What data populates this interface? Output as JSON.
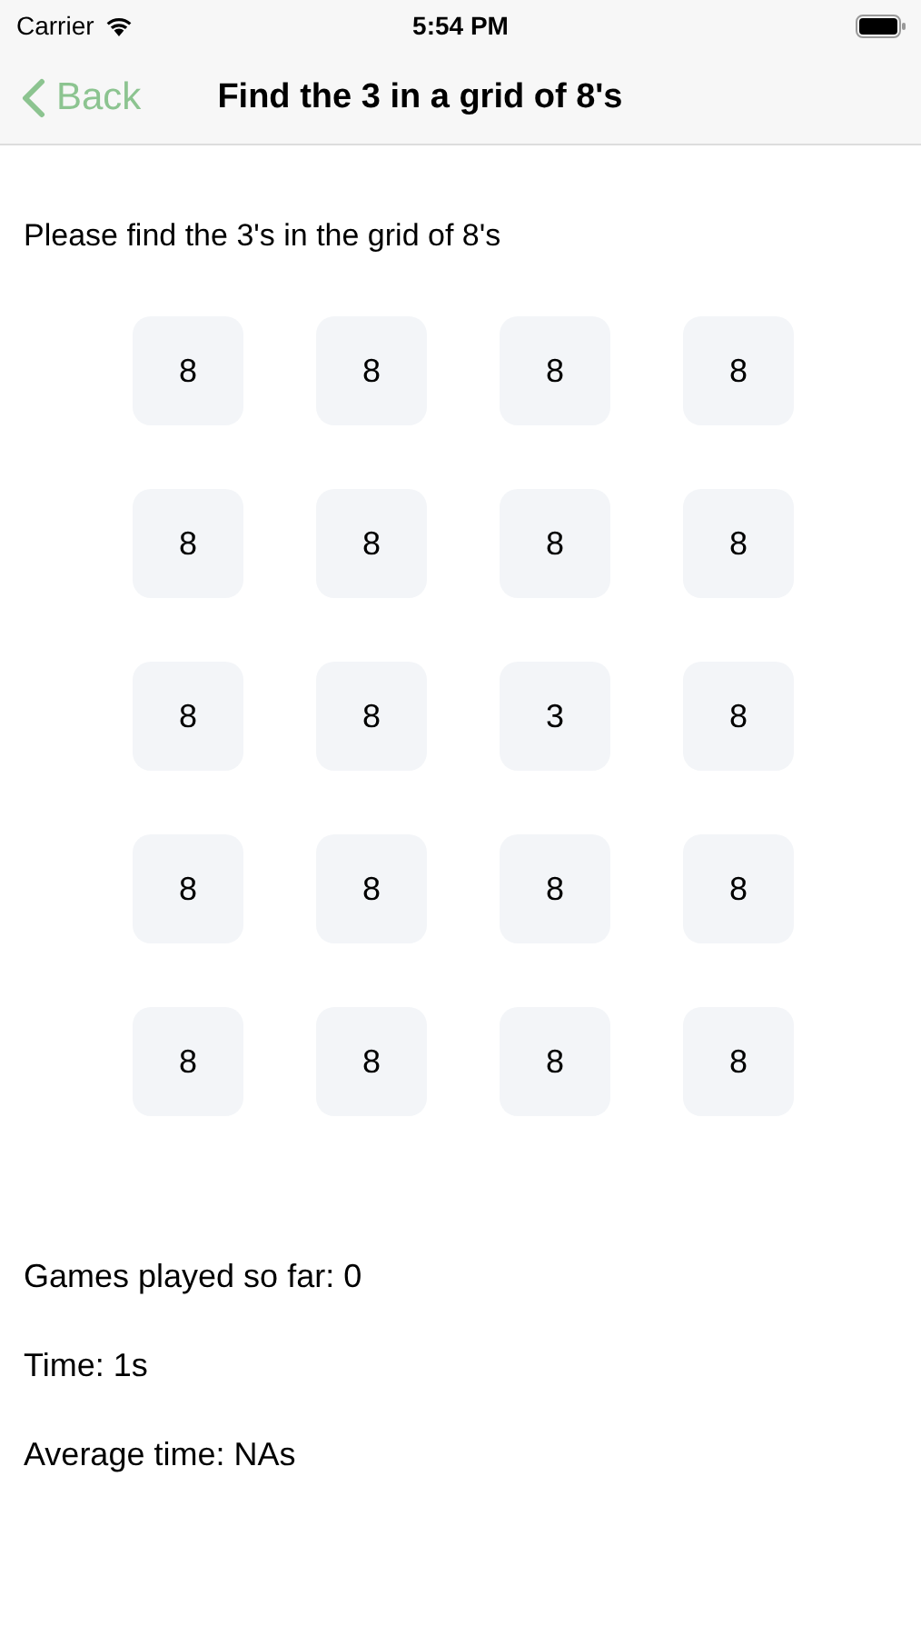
{
  "status_bar": {
    "carrier": "Carrier",
    "time": "5:54 PM"
  },
  "nav": {
    "back": "Back",
    "title": "Find the 3 in a grid of 8's"
  },
  "instruction": "Please find the 3's in the grid of 8's",
  "grid": [
    [
      "8",
      "8",
      "8",
      "8"
    ],
    [
      "8",
      "8",
      "8",
      "8"
    ],
    [
      "8",
      "8",
      "3",
      "8"
    ],
    [
      "8",
      "8",
      "8",
      "8"
    ],
    [
      "8",
      "8",
      "8",
      "8"
    ]
  ],
  "stats": [
    "Games played so far: 0",
    "Time: 1s",
    "Average time: NAs"
  ]
}
